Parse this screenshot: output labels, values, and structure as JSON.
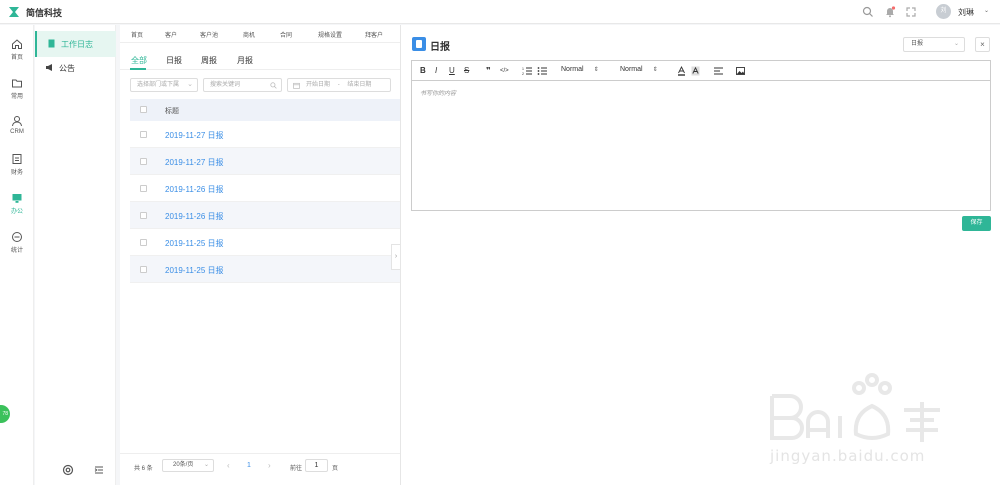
{
  "app": {
    "title": "简信科技",
    "brand_color": "#2fb697"
  },
  "topbar": {
    "icons": [
      "search-icon",
      "bell-icon",
      "fullscreen-icon"
    ],
    "user": {
      "avatar_text": "刘",
      "name": "刘琳",
      "caret": "⌄"
    }
  },
  "rail": {
    "items": [
      {
        "label": "首页",
        "icon": "home-icon"
      },
      {
        "label": "常用",
        "icon": "folder-icon"
      },
      {
        "label": "CRM",
        "icon": "user-icon"
      },
      {
        "label": "财务",
        "icon": "finance-icon"
      },
      {
        "label": "办公",
        "icon": "monitor-icon",
        "active": true
      },
      {
        "label": "统计",
        "icon": "stats-icon"
      }
    ],
    "float_badge": "78"
  },
  "subnav": {
    "items": [
      {
        "label": "工作日志",
        "icon": "book-icon",
        "active": true
      },
      {
        "label": "公告",
        "icon": "megaphone-icon"
      }
    ]
  },
  "main": {
    "crumbs": [
      "首页",
      "客户",
      "客户池",
      "商机",
      "合同",
      "规格设置",
      "拜客户"
    ],
    "tabs": [
      "全部",
      "日报",
      "周报",
      "月报"
    ],
    "filters": {
      "dept": "选择部门或下属",
      "keyword": "搜索关键词",
      "date_start": "开始日期",
      "date_sep": "-",
      "date_end": "结束日期"
    },
    "table": {
      "header": "标题",
      "rows": [
        {
          "title": "2019-11-27 日报"
        },
        {
          "title": "2019-11-27 日报"
        },
        {
          "title": "2019-11-26 日报"
        },
        {
          "title": "2019-11-26 日报"
        },
        {
          "title": "2019-11-25 日报"
        },
        {
          "title": "2019-11-25 日报"
        }
      ]
    },
    "pager": {
      "total": "共 6 条",
      "page_size": "20条/页",
      "current": "1",
      "goto_label": "前往",
      "goto_value": "1",
      "page_suffix": "页"
    }
  },
  "panel": {
    "title": "日报",
    "type_select": "日报",
    "close": "×",
    "toolbar": {
      "bold": "B",
      "italic": "I",
      "underline": "U",
      "strike": "S",
      "quote": "❞",
      "code": "</>",
      "header_select": "Normal",
      "size_select": "Normal"
    },
    "editor_placeholder": "书写你的内容",
    "save_label": "保存"
  },
  "watermark": {
    "text": "jingyan.baidu.com"
  }
}
